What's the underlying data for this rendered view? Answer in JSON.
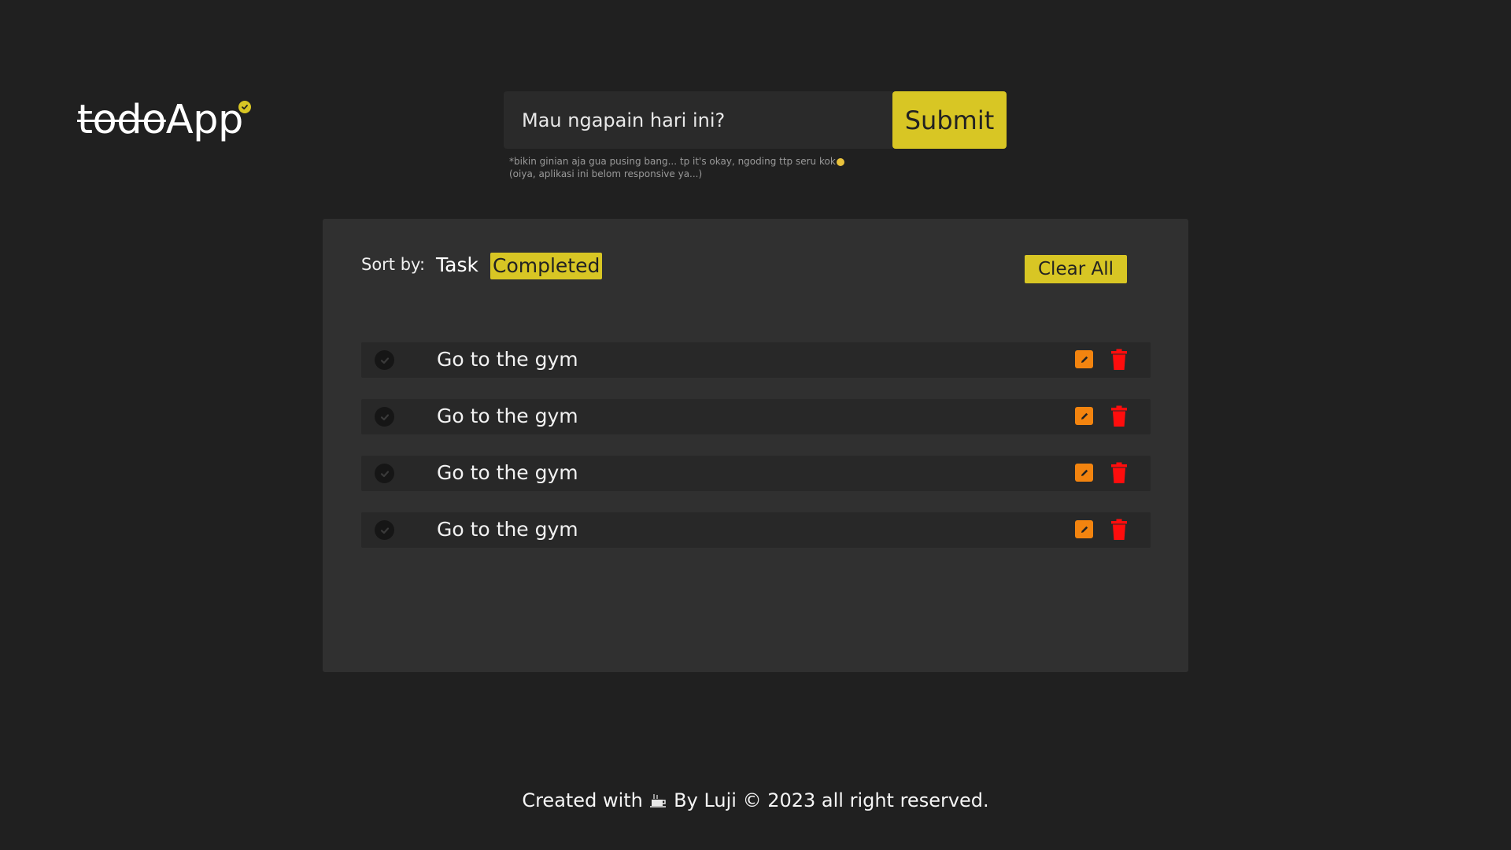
{
  "header": {
    "logo_struck": "todo",
    "logo_main": "App",
    "logo_badge_icon": "check-circle-icon"
  },
  "task_form": {
    "placeholder": "Mau ngapain hari ini?",
    "value": "",
    "submit_label": "Submit",
    "note_line1": "*bikin ginian aja gua pusing bang... tp it's okay, ngoding ttp seru kok",
    "note_line2": "(oiya, aplikasi ini belom responsive ya...)"
  },
  "toolbar": {
    "sort_label": "Sort by:",
    "sort_options": [
      {
        "label": "Task",
        "active": false
      },
      {
        "label": "Completed",
        "active": true
      }
    ],
    "clear_label": "Clear All"
  },
  "tasks": [
    {
      "text": "Go to the gym",
      "completed": true
    },
    {
      "text": "Go to the gym",
      "completed": true
    },
    {
      "text": "Go to the gym",
      "completed": true
    },
    {
      "text": "Go to the gym",
      "completed": true
    }
  ],
  "footer": {
    "prefix": "Created with",
    "icon": "coffee-icon",
    "suffix": "By Luji © 2023 all right reserved."
  },
  "colors": {
    "accent": "#d8c624",
    "background": "#202020",
    "panel": "#303030",
    "edit": "#f3840f",
    "delete": "#ff0d0d"
  }
}
